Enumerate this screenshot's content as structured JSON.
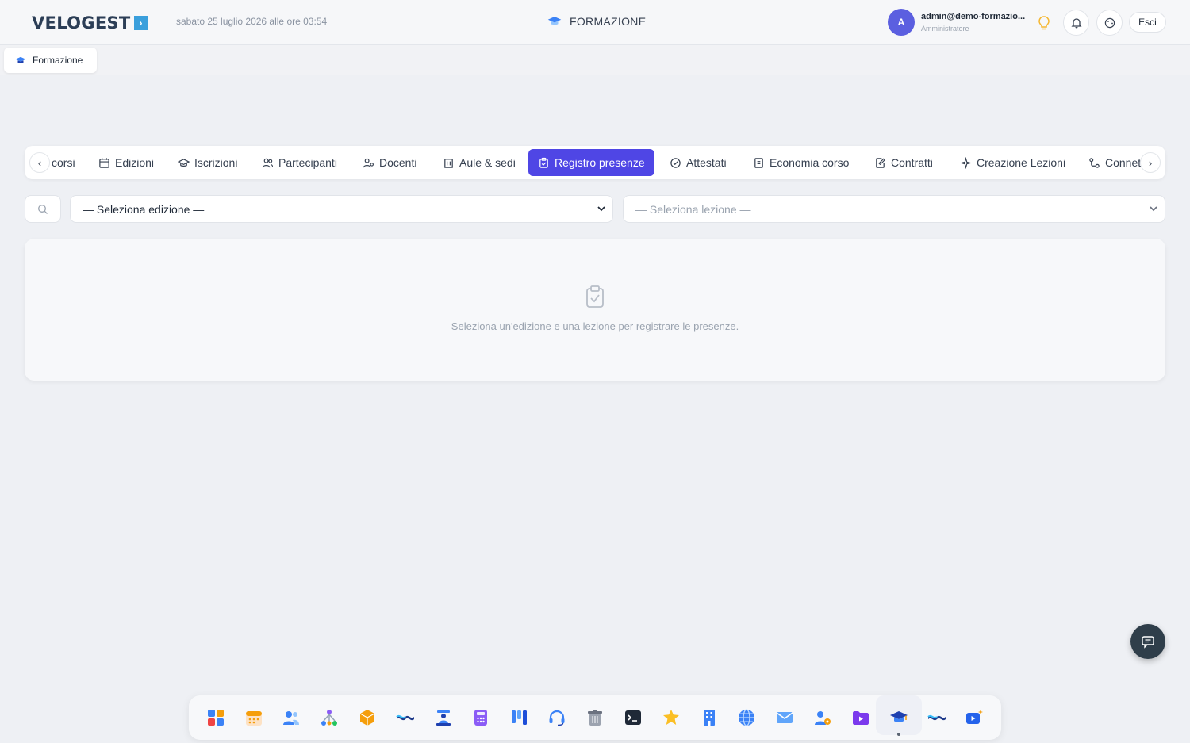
{
  "header": {
    "brand": "VELOGEST",
    "date": "sabato 25 luglio 2026 alle ore 03:54",
    "section_title": "FORMAZIONE",
    "user": {
      "initial": "A",
      "name": "admin@demo-formazio...",
      "role": "Amministratore"
    },
    "logout_label": "Esci"
  },
  "breadcrumb": {
    "label": "Formazione"
  },
  "tabs": [
    {
      "label": "corsi",
      "icon": "book-icon"
    },
    {
      "label": "Edizioni",
      "icon": "calendar-icon"
    },
    {
      "label": "Iscrizioni",
      "icon": "graduation-cap-icon"
    },
    {
      "label": "Partecipanti",
      "icon": "users-icon"
    },
    {
      "label": "Docenti",
      "icon": "teacher-icon"
    },
    {
      "label": "Aule & sedi",
      "icon": "building-icon"
    },
    {
      "label": "Registro presenze",
      "icon": "clipboard-check-icon",
      "active": true
    },
    {
      "label": "Attestati",
      "icon": "badge-check-icon"
    },
    {
      "label": "Economia corso",
      "icon": "receipt-icon"
    },
    {
      "label": "Contratti",
      "icon": "file-edit-icon"
    },
    {
      "label": "Creazione Lezioni",
      "icon": "sparkles-icon"
    },
    {
      "label": "Connet",
      "icon": "connections-icon"
    }
  ],
  "filters": {
    "edition_select": "— Seleziona edizione —",
    "lesson_select": "— Seleziona lezione —"
  },
  "empty_state": {
    "message": "Seleziona un'edizione e una lezione per registrare le presenze."
  },
  "dock": [
    "dashboard-icon",
    "calendar-icon",
    "users-icon",
    "network-icon",
    "package-icon",
    "wave-icon",
    "reception-icon",
    "calculator-icon",
    "kanban-icon",
    "headset-icon",
    "trash-icon",
    "terminal-icon",
    "star-icon",
    "office-building-icon",
    "globe-icon",
    "mail-icon",
    "user-settings-icon",
    "video-folder-icon",
    "graduation-cap-icon",
    "wave-icon-2",
    "video-spark-icon"
  ],
  "colors": {
    "accent": "#4f46e5",
    "background": "#eef0f4",
    "brand": "#2c3e56"
  }
}
